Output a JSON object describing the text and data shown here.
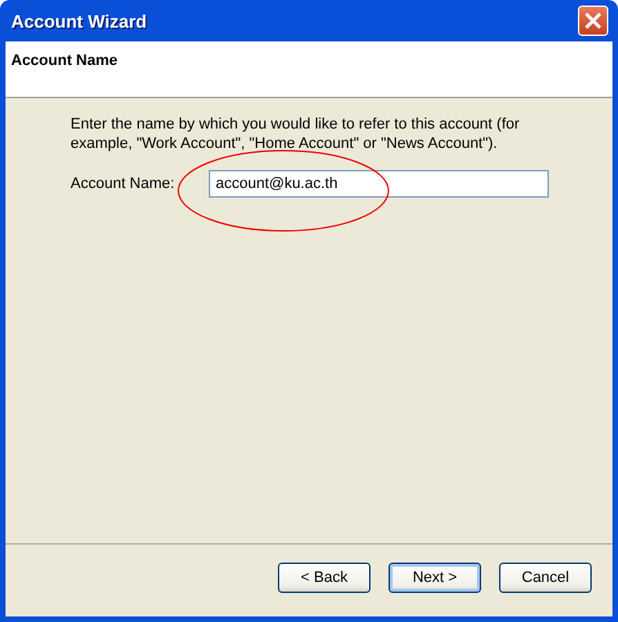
{
  "window": {
    "title": "Account Wizard"
  },
  "header": {
    "title": "Account Name"
  },
  "description": "Enter the name by which you would like to refer to this account (for example, \"Work Account\", \"Home Account\" or \"News Account\").",
  "field": {
    "label": "Account Name:",
    "value": "account@ku.ac.th"
  },
  "buttons": [
    {
      "label": "< Back",
      "default": false
    },
    {
      "label": "Next >",
      "default": true
    },
    {
      "label": "Cancel",
      "default": false
    }
  ]
}
